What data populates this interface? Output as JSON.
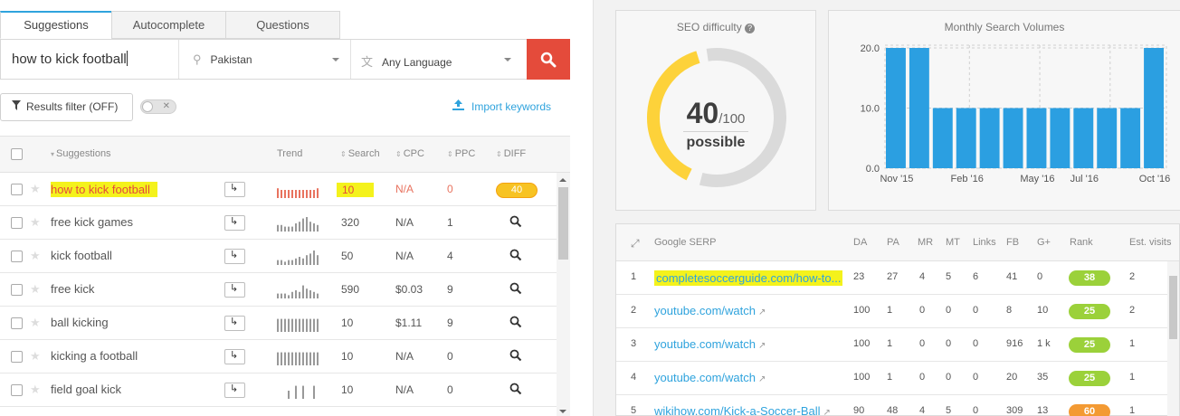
{
  "tabs": [
    "Suggestions",
    "Autocomplete",
    "Questions"
  ],
  "search": {
    "keyword": "how to kick football",
    "location": "Pakistan",
    "language": "Any Language"
  },
  "toolbar": {
    "filter_label": "Results filter (OFF)",
    "import_label": "Import keywords"
  },
  "table": {
    "headers": {
      "suggestions": "Suggestions",
      "trend": "Trend",
      "search": "Search",
      "cpc": "CPC",
      "ppc": "PPC",
      "diff": "DIFF"
    },
    "rows": [
      {
        "keyword": "how to kick football",
        "search": "10",
        "cpc": "N/A",
        "ppc": "0",
        "diff": "40",
        "trend": [
          6,
          5,
          5,
          5,
          5,
          5,
          5,
          5,
          5,
          5,
          5,
          6
        ],
        "highlight": true
      },
      {
        "keyword": "free kick games",
        "search": "320",
        "cpc": "N/A",
        "ppc": "1",
        "diff": "",
        "trend": [
          4,
          4,
          3,
          3,
          3,
          5,
          6,
          8,
          9,
          6,
          5,
          4
        ]
      },
      {
        "keyword": "kick football",
        "search": "50",
        "cpc": "N/A",
        "ppc": "4",
        "diff": "",
        "trend": [
          3,
          3,
          2,
          3,
          3,
          4,
          5,
          4,
          6,
          7,
          9,
          6
        ]
      },
      {
        "keyword": "free kick",
        "search": "590",
        "cpc": "$0.03",
        "ppc": "9",
        "diff": "",
        "trend": [
          3,
          3,
          3,
          2,
          4,
          5,
          4,
          8,
          6,
          5,
          4,
          3
        ]
      },
      {
        "keyword": "ball kicking",
        "search": "10",
        "cpc": "$1.11",
        "ppc": "9",
        "diff": "",
        "trend": [
          8,
          8,
          8,
          8,
          8,
          8,
          8,
          8,
          8,
          8,
          8,
          8
        ]
      },
      {
        "keyword": "kicking a football",
        "search": "10",
        "cpc": "N/A",
        "ppc": "0",
        "diff": "",
        "trend": [
          8,
          8,
          8,
          8,
          8,
          8,
          8,
          8,
          8,
          8,
          8,
          8
        ]
      },
      {
        "keyword": "field goal kick",
        "search": "10",
        "cpc": "N/A",
        "ppc": "0",
        "diff": "",
        "trend": [
          0,
          0,
          0,
          5,
          0,
          8,
          0,
          8,
          0,
          0,
          8,
          0
        ]
      }
    ]
  },
  "seo": {
    "title": "SEO difficulty",
    "value": 40,
    "max_label": "/100",
    "label": "possible",
    "colors": {
      "fill": "#fdd23a",
      "track": "#dadada"
    }
  },
  "volumes": {
    "title": "Monthly Search Volumes",
    "chart_data": {
      "type": "bar",
      "title": "Monthly Search Volumes",
      "x_ticks": [
        "Nov '15",
        "Feb '16",
        "May '16",
        "Jul '16",
        "Oct '16"
      ],
      "y_ticks": [
        "0.0",
        "10.0",
        "20.0"
      ],
      "values": [
        20,
        20,
        10,
        10,
        10,
        10,
        10,
        10,
        10,
        10,
        10,
        20
      ],
      "ylim": [
        0,
        20
      ],
      "color": "#2b9fe1"
    }
  },
  "serp": {
    "headers": [
      "Google SERP",
      "DA",
      "PA",
      "MR",
      "MT",
      "Links",
      "FB",
      "G+",
      "Rank",
      "Est. visits"
    ],
    "rows": [
      {
        "n": "1",
        "url": "completesoccerguide.com/how-to...",
        "da": "23",
        "pa": "27",
        "mr": "4",
        "mt": "5",
        "links": "6",
        "fb": "41",
        "g": "0",
        "rank": "38",
        "visits": "2",
        "highlight": true
      },
      {
        "n": "2",
        "url": "youtube.com/watch",
        "da": "100",
        "pa": "1",
        "mr": "0",
        "mt": "0",
        "links": "0",
        "fb": "8",
        "g": "10",
        "rank": "25",
        "visits": "2"
      },
      {
        "n": "3",
        "url": "youtube.com/watch",
        "da": "100",
        "pa": "1",
        "mr": "0",
        "mt": "0",
        "links": "0",
        "fb": "916",
        "g": "1 k",
        "rank": "25",
        "visits": "1"
      },
      {
        "n": "4",
        "url": "youtube.com/watch",
        "da": "100",
        "pa": "1",
        "mr": "0",
        "mt": "0",
        "links": "0",
        "fb": "20",
        "g": "35",
        "rank": "25",
        "visits": "1"
      },
      {
        "n": "5",
        "url": "wikihow.com/Kick-a-Soccer-Ball",
        "da": "90",
        "pa": "48",
        "mr": "4",
        "mt": "5",
        "links": "0",
        "fb": "309",
        "g": "13",
        "rank": "60",
        "visits": "1"
      }
    ],
    "rank_colors": {
      "good": "#9bd13a",
      "mid": "#f39a33"
    }
  }
}
